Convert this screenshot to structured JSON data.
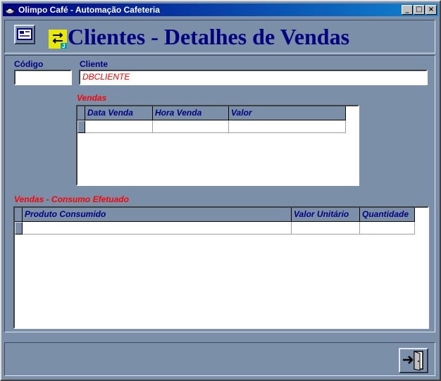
{
  "window": {
    "title": "Olimpo Café - Automação Cafeteria",
    "minimize_label": "_",
    "maximize_label": "□",
    "close_label": "×"
  },
  "header": {
    "title": "Clientes - Detalhes de Vendas"
  },
  "form": {
    "codigo_label": "Código",
    "codigo_value": "",
    "cliente_label": "Cliente",
    "cliente_value": "DBCLIENTE"
  },
  "vendas": {
    "label": "Vendas",
    "columns": [
      "Data Venda",
      "Hora Venda",
      "Valor"
    ]
  },
  "consumo": {
    "label": "Vendas - Consumo Efetuado",
    "columns": [
      "Produto Consumido",
      "Valor Unitário",
      "Quantidade"
    ]
  },
  "icons": {
    "record_button": "card-icon",
    "app_logo": "exchange-icon",
    "exit_button": "exit-door-icon"
  }
}
